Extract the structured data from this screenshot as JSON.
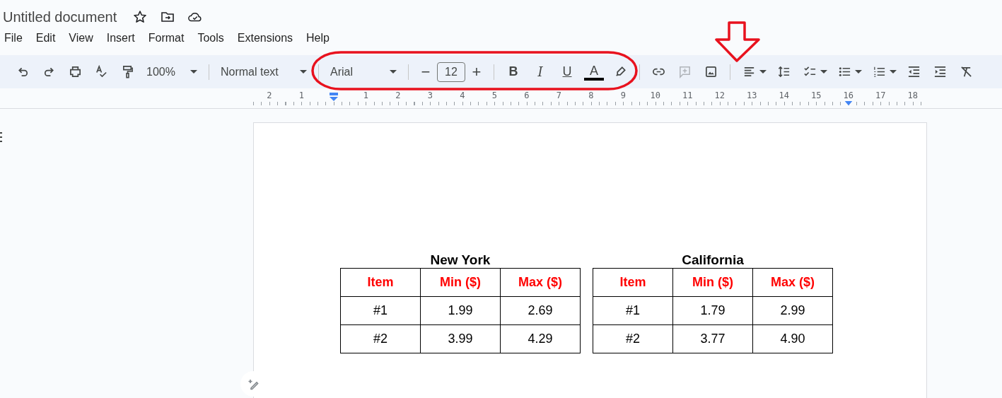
{
  "document": {
    "title": "Untitled document"
  },
  "menu": [
    "File",
    "Edit",
    "View",
    "Insert",
    "Format",
    "Tools",
    "Extensions",
    "Help"
  ],
  "toolbar": {
    "zoom": "100%",
    "style": "Normal text",
    "font": "Arial",
    "size_minus": "−",
    "font_size": "12",
    "size_plus": "+",
    "format_keys": [
      {
        "label": "B",
        "kind": "bold"
      },
      {
        "label": "I",
        "kind": "italic"
      },
      {
        "label": "U",
        "kind": "underline"
      },
      {
        "label": "A",
        "kind": "color"
      }
    ],
    "add_comment": {
      "disabled": true
    }
  },
  "ruler": {
    "before_indent": [
      "2",
      "1"
    ],
    "after_indent": [
      "1",
      "2",
      "3",
      "4",
      "5",
      "6",
      "7",
      "8",
      "9",
      "10",
      "11",
      "12",
      "13",
      "14",
      "15",
      "16",
      "17",
      "18"
    ]
  },
  "tables": [
    {
      "caption": "New York",
      "columns": [
        "Item",
        "Min ($)",
        "Max ($)"
      ],
      "rows": [
        [
          "#1",
          "1.99",
          "2.69"
        ],
        [
          "#2",
          "3.99",
          "4.29"
        ]
      ]
    },
    {
      "caption": "California",
      "columns": [
        "Item",
        "Min ($)",
        "Max ($)"
      ],
      "rows": [
        [
          "#1",
          "1.79",
          "2.99"
        ],
        [
          "#2",
          "3.77",
          "4.90"
        ]
      ]
    }
  ]
}
